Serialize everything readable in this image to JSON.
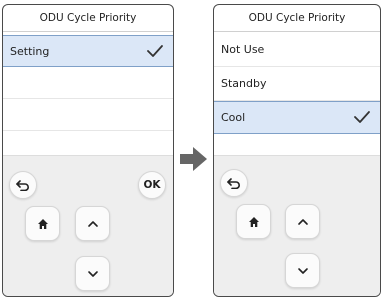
{
  "left_screen": {
    "title": "ODU Cycle Priority",
    "rows": [
      {
        "label": "Setting",
        "selected": true
      }
    ],
    "keys": {
      "ok_label": "OK"
    }
  },
  "right_screen": {
    "title": "ODU Cycle Priority",
    "rows": [
      {
        "label": "Not Use",
        "selected": false
      },
      {
        "label": "Standby",
        "selected": false
      },
      {
        "label": "Cool",
        "selected": true
      }
    ]
  },
  "icons": {
    "check": "check-icon",
    "back": "back-arrow-icon",
    "home": "home-icon",
    "up": "chevron-up-icon",
    "down": "chevron-down-icon",
    "transition": "right-arrow-icon"
  },
  "colors": {
    "selected_background": "#dbe7f7",
    "selected_border": "#7fa0c8",
    "keypad_background": "#eeeeee",
    "transition_arrow": "#666666"
  }
}
